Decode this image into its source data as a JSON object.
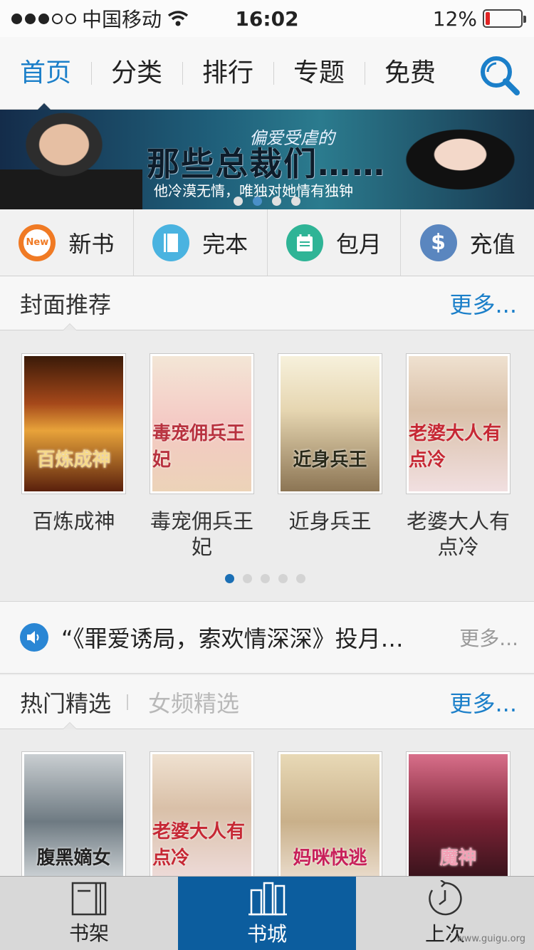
{
  "status": {
    "carrier": "中国移动",
    "time": "16:02",
    "battery": "12%",
    "battery_level": 0.12
  },
  "nav": {
    "tabs": [
      "首页",
      "分类",
      "排行",
      "专题",
      "免费"
    ],
    "active_index": 0,
    "search_icon": "search-icon"
  },
  "banner": {
    "small_text": "偏爱受虐的",
    "big_text": "那些总裁们……",
    "subtitle": "他冷漠无情，唯独对她情有独钟",
    "page_count": 4,
    "active_page": 1
  },
  "quick": [
    {
      "label": "新书",
      "icon": "new-badge-icon",
      "icon_text": "New",
      "color": "#f07a24"
    },
    {
      "label": "完本",
      "icon": "book-icon",
      "icon_text": "",
      "color": "#4ab3e0"
    },
    {
      "label": "包月",
      "icon": "calendar-icon",
      "icon_text": "",
      "color": "#2fb496"
    },
    {
      "label": "充值",
      "icon": "dollar-icon",
      "icon_text": "$",
      "color": "#5a86bf"
    }
  ],
  "cover_section": {
    "title": "封面推荐",
    "more": "更多...",
    "books": [
      {
        "title": "百炼成神",
        "cover_text": "百炼成神"
      },
      {
        "title": "毒宠佣兵王妃",
        "cover_text": "毒宠佣兵王妃"
      },
      {
        "title": "近身兵王",
        "cover_text": "近身兵王"
      },
      {
        "title": "老婆大人有点冷",
        "cover_text": "老婆大人有点冷"
      }
    ],
    "pages": 5,
    "active_page": 0
  },
  "notice": {
    "text": "“《罪爱诱局，索欢情深深》投月…",
    "more": "更多..."
  },
  "hot_section": {
    "title": "热门精选",
    "tab2": "女频精选",
    "more": "更多...",
    "books": [
      {
        "cover_text": "腹黑嫡女"
      },
      {
        "cover_text": "老婆大人有点冷"
      },
      {
        "cover_text": "妈咪快逃"
      },
      {
        "cover_text": "魔神"
      }
    ]
  },
  "tabbar": {
    "tabs": [
      {
        "label": "书架",
        "icon": "bookshelf-icon"
      },
      {
        "label": "书城",
        "icon": "bookstore-icon"
      },
      {
        "label": "上次",
        "icon": "history-icon"
      }
    ],
    "active_index": 1
  },
  "watermark": "www.guigu.org"
}
